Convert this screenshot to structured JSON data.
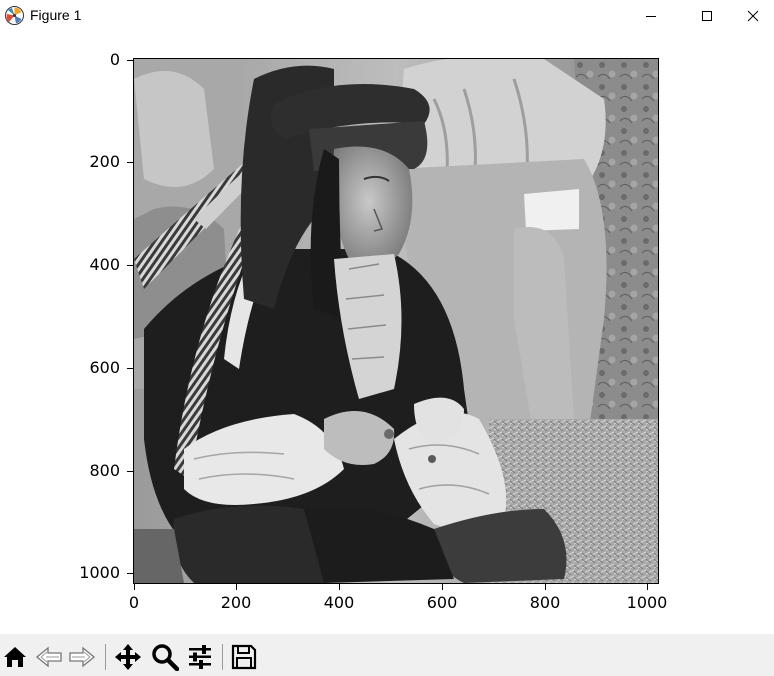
{
  "window": {
    "title": "Figure 1",
    "app_icon": "matplotlib-icon",
    "controls": [
      "minimize-icon",
      "maximize-icon",
      "close-icon"
    ]
  },
  "figure": {
    "image_description": "grayscale image of a man wearing a feathered hat and ruffled shirt",
    "colors": {
      "background": "#ffffff",
      "toolbar": "#f0f0f0",
      "axes": "#000000"
    },
    "axes": {
      "x": {
        "ticks": [
          0,
          200,
          400,
          600,
          800,
          1000
        ],
        "labels": [
          "0",
          "200",
          "400",
          "600",
          "800",
          "1000"
        ],
        "range": [
          0,
          1024
        ]
      },
      "y": {
        "ticks": [
          0,
          200,
          400,
          600,
          800,
          1000
        ],
        "labels": [
          "0",
          "200",
          "400",
          "600",
          "800",
          "1000"
        ],
        "range": [
          0,
          1024
        ],
        "inverted": true
      }
    }
  },
  "toolbar": {
    "tools": [
      "home-icon",
      "back-icon",
      "forward-icon",
      "pan-icon",
      "zoom-icon",
      "configure-subplots-icon",
      "save-icon"
    ]
  }
}
